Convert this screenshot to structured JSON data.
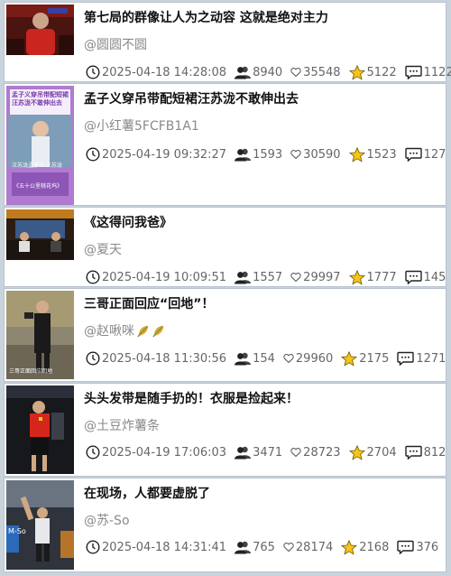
{
  "items": [
    {
      "title": "第七局的群像让人为之动容 这就是绝对主力",
      "author": "@圆圆不圆",
      "date": "2025-04-18 14:28:08",
      "users": "8940",
      "likes": "35548",
      "stars": "5122",
      "comments": "1122"
    },
    {
      "title": "孟子义穿吊带配短裙汪苏泷不敢伸出去",
      "author": "@小红薯5FCFB1A1",
      "date": "2025-04-19 09:32:27",
      "users": "1593",
      "likes": "30590",
      "stars": "1523",
      "comments": "127"
    },
    {
      "title": "《这得问我爸》",
      "author": "@夏天",
      "date": "2025-04-19 10:09:51",
      "users": "1557",
      "likes": "29997",
      "stars": "1777",
      "comments": "145"
    },
    {
      "title": "三哥正面回应“回地”！",
      "author": "@赵啾咪",
      "date": "2025-04-18 11:30:56",
      "users": "154",
      "likes": "29960",
      "stars": "2175",
      "comments": "1271"
    },
    {
      "title": "头头发带是随手扔的！衣服是捡起来！",
      "author": "@土豆炸薯条",
      "date": "2025-04-19 17:06:03",
      "users": "3471",
      "likes": "28723",
      "stars": "2704",
      "comments": "812"
    },
    {
      "title": "在现场，人都要虚脱了",
      "author": "@苏-So",
      "date": "2025-04-18 14:31:41",
      "users": "765",
      "likes": "28174",
      "stars": "2168",
      "comments": "376"
    }
  ],
  "thumb_texts": {
    "t2_top": "孟子义穿吊带配短裙汪苏泷不敢伸出去",
    "t2_mid": "汪苏泷孟子义 汪苏泷",
    "t2_bot": "《五十公里桃花坞》",
    "t4_cap": "三哥正面回应回地",
    "t6_cap": "M-So"
  },
  "colors": {
    "star": "#f5c518",
    "badge_green": "#5aa832",
    "badge_orange": "#e8a13a"
  }
}
